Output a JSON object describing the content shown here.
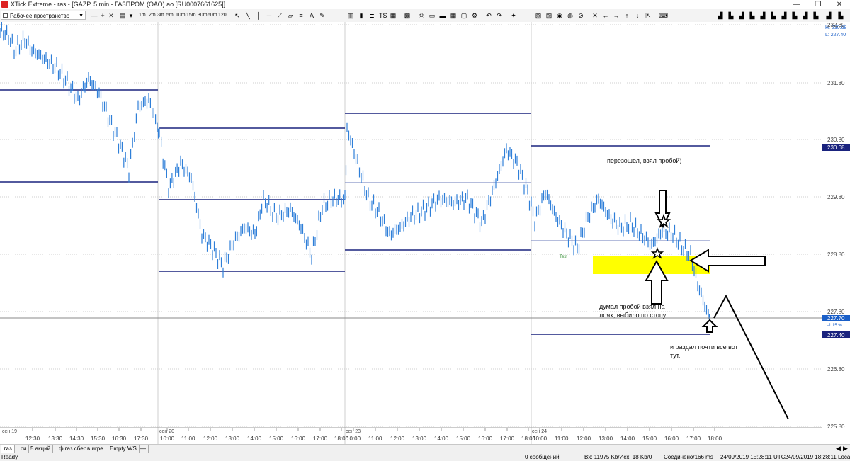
{
  "window": {
    "title": "XTick Extreme - газ - [GAZP, 5 min - ГАЗПРОМ (ОАО) ао [RU0007661625]]",
    "minimize": "—",
    "maximize": "❐",
    "close": "✕"
  },
  "toolbar": {
    "workspace": "Рабочее пространство",
    "timeframes": [
      "1m",
      "2m",
      "3m",
      "5m",
      "10m",
      "15m",
      "30m",
      "60m",
      "120"
    ]
  },
  "chart": {
    "high_label": "H: 230.68",
    "low_label": "L: 227.40",
    "price_ticks": [
      "232.80",
      "231.80",
      "230.80",
      "229.80",
      "228.80",
      "227.80",
      "226.80",
      "225.80"
    ],
    "current_price": "227.70",
    "change_pct": "-1.15 %",
    "high_badge": "230.68",
    "low_badge": "227.40",
    "day_labels": [
      "сен 19",
      "сен 20",
      "сен 23",
      "сен 24"
    ],
    "time_labels": [
      "12:30",
      "13:30",
      "14:30",
      "15:30",
      "16:30",
      "17:30",
      "10:00",
      "11:00",
      "12:00",
      "13:00",
      "14:00",
      "15:00",
      "16:00",
      "17:00",
      "18:00",
      "10:00",
      "11:00",
      "12:00",
      "13:00",
      "14:00",
      "15:00",
      "16:00",
      "17:00",
      "18:00",
      "10:00",
      "11:00",
      "12:00",
      "13:00",
      "14:00",
      "15:00",
      "16:00",
      "17:00",
      "18:00"
    ],
    "annotation_1": "перезошел, взял пробой)",
    "annotation_2_line1": "думал пробой взял на",
    "annotation_2_line2": "лоях, выбило по стопу.",
    "annotation_3_line1": "и раздал почти все вот",
    "annotation_3_line2": "тут.",
    "text_marker": "Text",
    "colors": {
      "candles": "#2f7fd8",
      "levels": "#1a237e",
      "highlight": "#ffff00"
    }
  },
  "tabs": [
    "газ",
    "си",
    "5 акций",
    "ф газ сбер",
    "в игре",
    "Empty WS",
    "—"
  ],
  "status": {
    "ready": "Ready",
    "messages": "0 сообщений",
    "traffic": "Вх: 11975 Kb/Исх: 18 Kb/0",
    "connection": "Соединено/166 ms",
    "utc": "24/09/2019 15:28:11 UTC",
    "local": "24/09/2019 18:28:11 Local"
  }
}
